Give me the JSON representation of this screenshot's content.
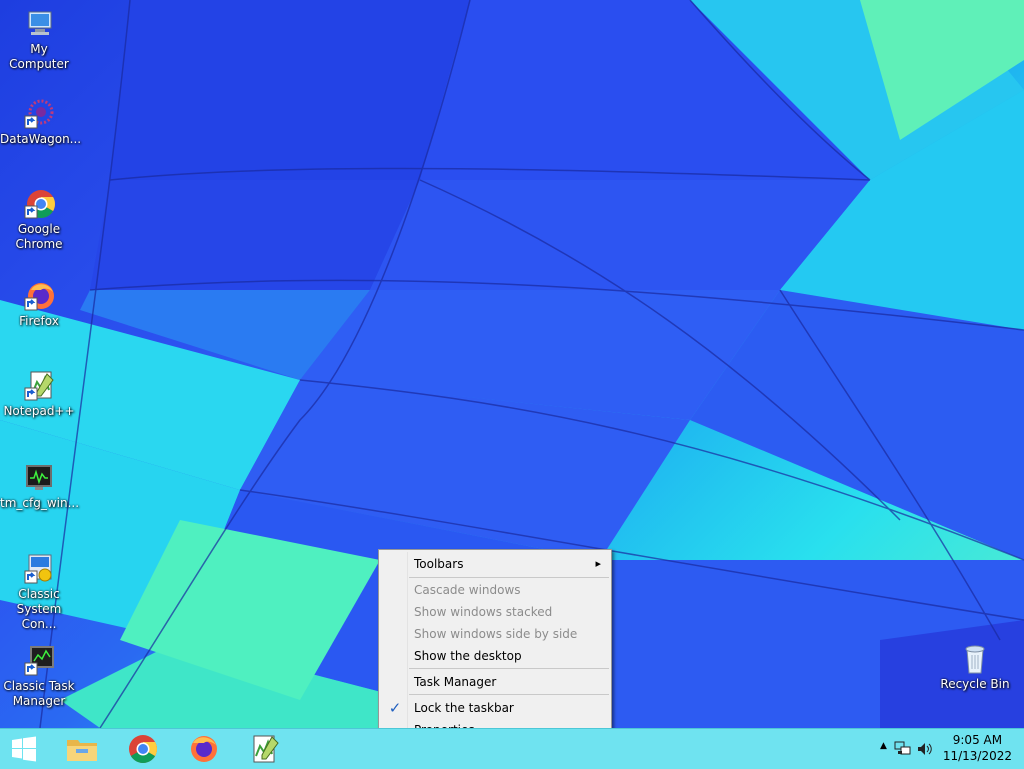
{
  "desktop_icons": [
    {
      "label": "My Computer",
      "icon": "computer-icon"
    },
    {
      "label": "DataWagon...",
      "icon": "datawagon-shortcut-icon"
    },
    {
      "label": "Google Chrome",
      "icon": "chrome-shortcut-icon"
    },
    {
      "label": "Firefox",
      "icon": "firefox-shortcut-icon"
    },
    {
      "label": "Notepad++",
      "icon": "notepadpp-shortcut-icon"
    },
    {
      "label": "tm_cfg_win...",
      "icon": "tm-cfg-monitor-icon"
    },
    {
      "label": "Classic System Con...",
      "icon": "classic-control-panel-icon"
    },
    {
      "label": "Classic Task Manager",
      "icon": "classic-task-manager-icon"
    },
    {
      "label": "Recycle Bin",
      "icon": "recycle-bin-icon"
    }
  ],
  "context_menu": {
    "toolbars": "Toolbars",
    "cascade": "Cascade windows",
    "stacked": "Show windows stacked",
    "side_by_side": "Show windows side by side",
    "show_desktop": "Show the desktop",
    "task_manager": "Task Manager",
    "lock_taskbar": "Lock the taskbar",
    "lock_checked": true,
    "properties": "Properties",
    "check_mark": "✓",
    "submenu_arrow": "▸"
  },
  "taskbar": {
    "pinned": [
      "start-windows-icon",
      "file-explorer-icon",
      "chrome-icon",
      "firefox-icon",
      "notepadpp-icon"
    ],
    "tray": {
      "time": "9:05 AM",
      "date": "11/13/2022",
      "chevron": "▲"
    }
  },
  "colors": {
    "taskbar": "#6fe3f0",
    "menu_bg": "#f0f0f0",
    "check": "#1f5fbf"
  }
}
